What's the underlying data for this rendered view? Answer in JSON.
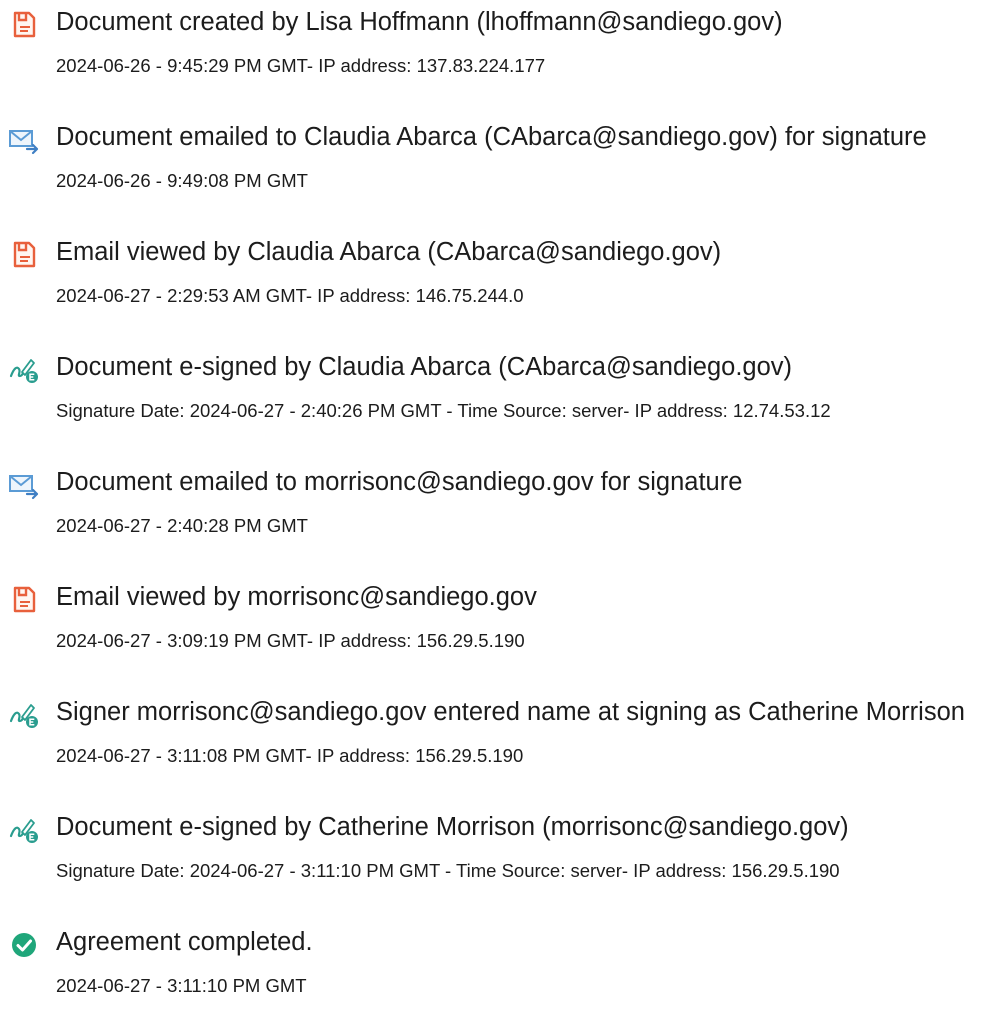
{
  "events": [
    {
      "icon": "document-created-icon",
      "title": "Document created by Lisa Hoffmann (lhoffmann@sandiego.gov)",
      "detail": "2024-06-26 - 9:45:29 PM GMT- IP address: 137.83.224.177"
    },
    {
      "icon": "email-sent-icon",
      "title": "Document emailed to Claudia Abarca (CAbarca@sandiego.gov) for signature",
      "detail": "2024-06-26 - 9:49:08 PM GMT"
    },
    {
      "icon": "email-viewed-icon",
      "title": "Email viewed by Claudia Abarca (CAbarca@sandiego.gov)",
      "detail": "2024-06-27 - 2:29:53 AM GMT- IP address: 146.75.244.0"
    },
    {
      "icon": "e-signed-icon",
      "title": "Document e-signed by Claudia Abarca (CAbarca@sandiego.gov)",
      "detail": "Signature Date: 2024-06-27 - 2:40:26 PM GMT - Time Source: server- IP address: 12.74.53.12"
    },
    {
      "icon": "email-sent-icon",
      "title": "Document emailed to morrisonc@sandiego.gov for signature",
      "detail": "2024-06-27 - 2:40:28 PM GMT"
    },
    {
      "icon": "email-viewed-icon",
      "title": "Email viewed by morrisonc@sandiego.gov",
      "detail": "2024-06-27 - 3:09:19 PM GMT- IP address: 156.29.5.190"
    },
    {
      "icon": "e-signed-icon",
      "title": "Signer morrisonc@sandiego.gov entered name at signing as Catherine Morrison",
      "detail": "2024-06-27 - 3:11:08 PM GMT- IP address: 156.29.5.190"
    },
    {
      "icon": "e-signed-icon",
      "title": "Document e-signed by Catherine Morrison (morrisonc@sandiego.gov)",
      "detail": "Signature Date: 2024-06-27 - 3:11:10 PM GMT - Time Source: server- IP address: 156.29.5.190"
    },
    {
      "icon": "agreement-completed-icon",
      "title": "Agreement completed.",
      "detail": "2024-06-27 - 3:11:10 PM GMT"
    }
  ],
  "colors": {
    "document_icon": "#e8603c",
    "email_icon": "#5b9bd5",
    "signature_icon": "#2a9d8f",
    "completed_icon": "#1fa67a",
    "text": "#1c1c1c"
  }
}
